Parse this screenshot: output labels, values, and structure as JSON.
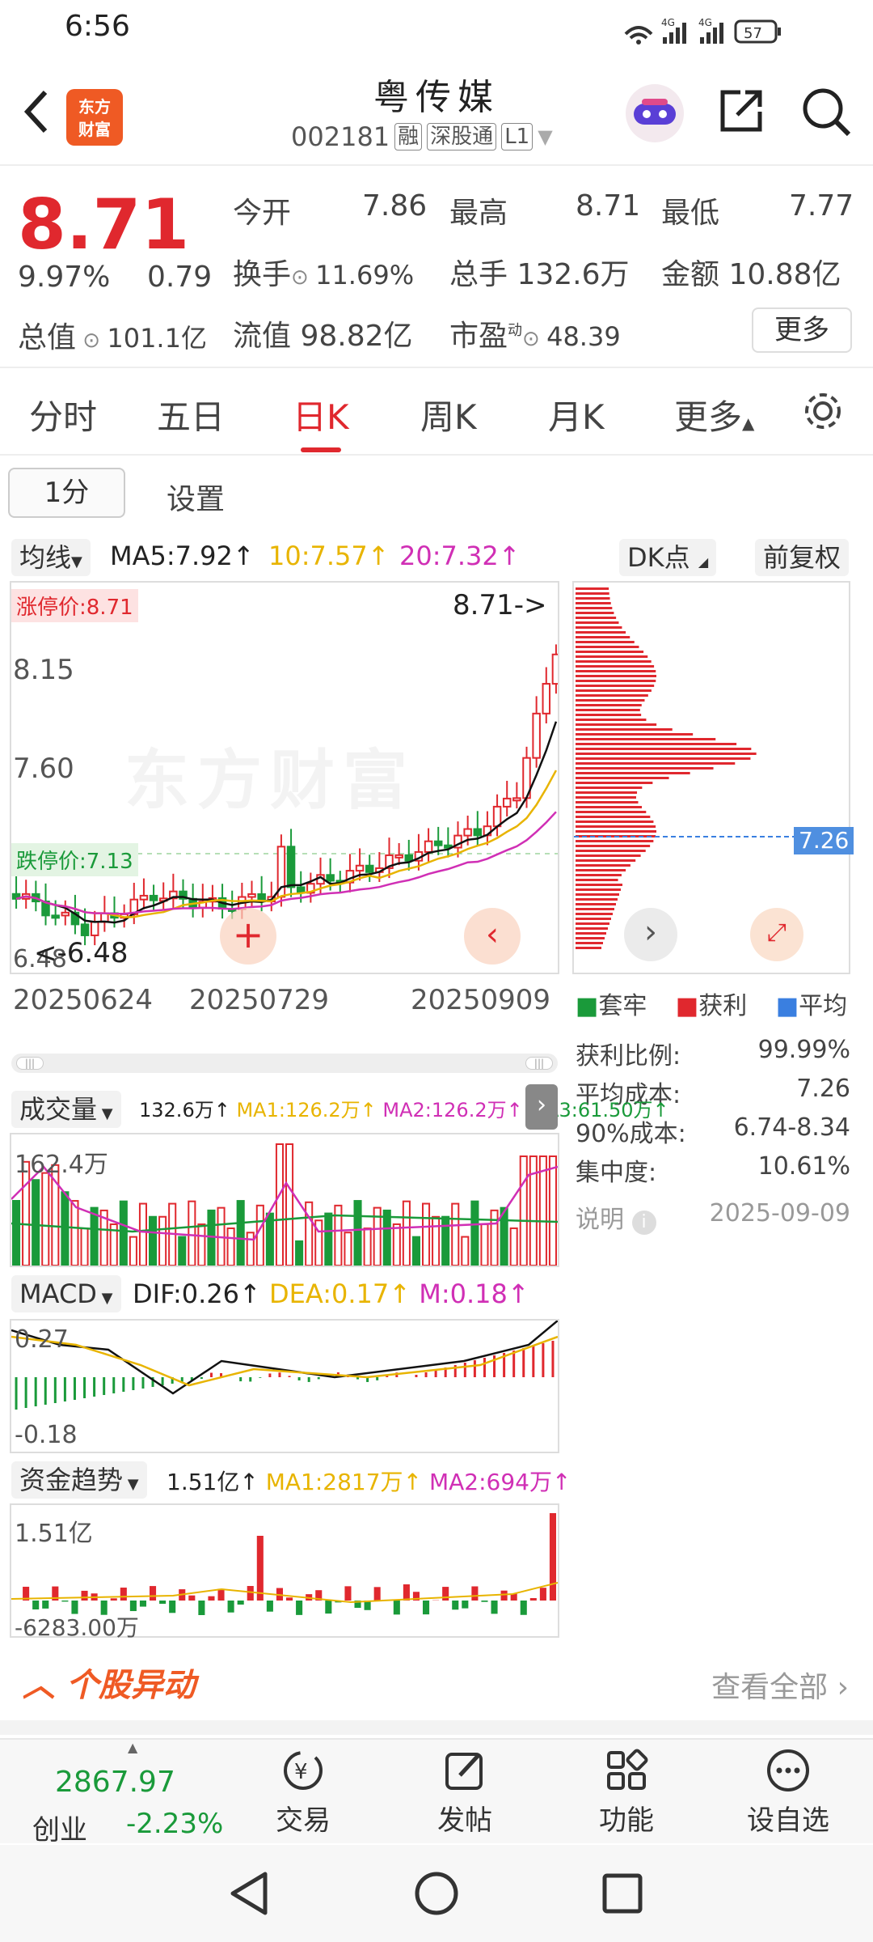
{
  "status": {
    "time": "6:56",
    "battery": "57"
  },
  "header": {
    "logo_line1": "东方",
    "logo_line2": "财富",
    "title": "粤传媒",
    "code": "002181",
    "tags": [
      "融",
      "深股通",
      "L1"
    ]
  },
  "quote": {
    "price": "8.71",
    "change_pct": "9.97%",
    "change": "0.79",
    "open_label": "今开",
    "open": "7.86",
    "high_label": "最高",
    "high": "8.71",
    "low_label": "最低",
    "low": "7.77",
    "turnover_label": "换手",
    "turnover": "11.69%",
    "vol_label": "总手",
    "vol": "132.6万",
    "amount_label": "金额",
    "amount": "10.88亿",
    "mcap_label": "总值",
    "mcap": "101.1亿",
    "float_label": "流值",
    "float": "98.82亿",
    "pe_label": "市盈",
    "pe_sup": "动",
    "pe": "48.39",
    "more": "更多"
  },
  "tabs": [
    "分时",
    "五日",
    "日K",
    "周K",
    "月K",
    "更多"
  ],
  "sub": {
    "period": "1分",
    "settings": "设置"
  },
  "ma": {
    "selector": "均线",
    "ma5": "MA5:7.92",
    "ma10": "10:7.57",
    "ma20": "20:7.32",
    "dk": "DK点",
    "fq": "前复权"
  },
  "kline": {
    "limit_up": "涨停价:8.71",
    "limit_down": "跌停价:7.13",
    "y1": "8.15",
    "y2": "7.60",
    "y_top": "8.71",
    "y_bot": "6.48",
    "max_label": "8.71->",
    "min_label": "<-6.48",
    "dates": [
      "20250624",
      "20250729",
      "20250909"
    ],
    "watermark": "东方财富"
  },
  "chip": {
    "avg_label": "7.26",
    "legend": [
      "套牢",
      "获利",
      "平均"
    ],
    "rows": [
      [
        "获利比例:",
        "99.99%"
      ],
      [
        "平均成本:",
        "7.26"
      ],
      [
        "90%成本:",
        "6.74-8.34"
      ],
      [
        "集中度:",
        "10.61%"
      ]
    ],
    "note": "说明",
    "date": "2025-09-09"
  },
  "vol": {
    "selector": "成交量",
    "v": "132.6万",
    "ma1": "MA1:126.2万",
    "ma2": "MA2:126.2万",
    "ma3": "MA3:61.50万",
    "top": "162.4万"
  },
  "macd": {
    "selector": "MACD",
    "dif": "DIF:0.26",
    "dea": "DEA:0.17",
    "m": "M:0.18",
    "top": "0.27",
    "bot": "-0.18"
  },
  "fund": {
    "selector": "资金趋势",
    "v": "1.51亿",
    "ma1": "MA1:2817万",
    "ma2": "MA2:694万",
    "top": "1.51亿",
    "bot": "-6283.00万"
  },
  "alert": {
    "title": "个股异动",
    "link": "查看全部"
  },
  "nav": {
    "index_value": "2867.97",
    "index_name": "创业",
    "index_change": "-2.23%",
    "items": [
      "交易",
      "发帖",
      "功能",
      "设自选"
    ]
  },
  "colors": {
    "up": "#e0282e",
    "down": "#1a9a3a",
    "ma10": "#e8b400",
    "ma20": "#d02fb5",
    "accent": "#ef5a24"
  }
}
